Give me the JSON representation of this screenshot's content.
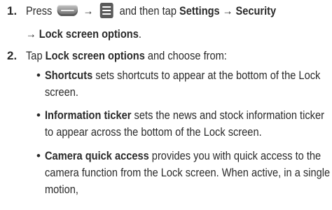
{
  "step1": {
    "number": "1.",
    "press": "Press",
    "arrow": "→",
    "and_then_tap": "and then tap",
    "settings": "Settings",
    "arrow2": "→",
    "security": "Security",
    "arrow3": "→",
    "lock_screen_options": "Lock screen options",
    "period": ".",
    "icons": [
      "home-key-icon",
      "menu-key-icon"
    ]
  },
  "step2": {
    "number": "2.",
    "tap": "Tap",
    "lock_screen_options": "Lock screen options",
    "choose": "and choose from:",
    "items": [
      {
        "bullet": "•",
        "term": "Shortcuts",
        "line1": "sets shortcuts to appear at the bottom of the Lock",
        "line2": "screen."
      },
      {
        "bullet": "•",
        "term": "Information ticker",
        "line1": "sets the news and stock information ticker",
        "line2": "to appear across the bottom of the Lock screen."
      },
      {
        "bullet": "•",
        "term": "Camera quick access",
        "line1": "provides you with quick access to the",
        "line2": "camera function from the Lock screen. When active, in a single",
        "line3": "motion,"
      }
    ]
  }
}
